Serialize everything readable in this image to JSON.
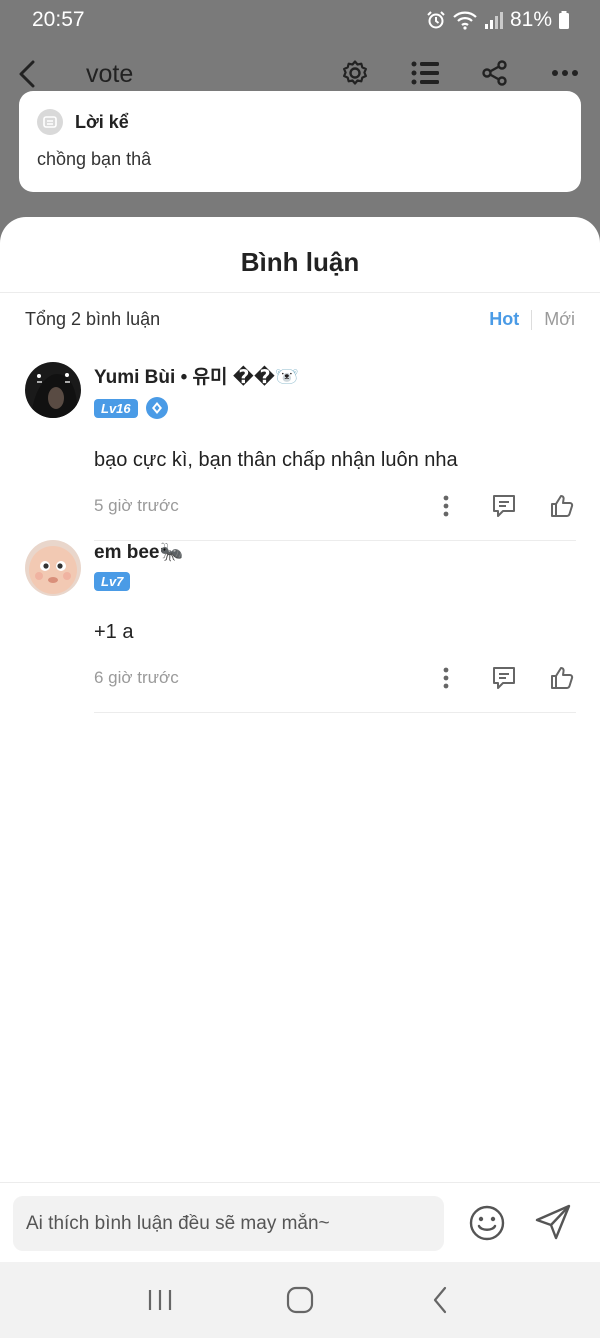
{
  "status_bar": {
    "time": "20:57",
    "battery": "81%"
  },
  "header": {
    "title": "vote",
    "icons": [
      "back-icon",
      "settings-icon",
      "list-icon",
      "share-icon",
      "more-icon"
    ]
  },
  "narration": {
    "label": "Lời kể",
    "text": "chồng bạn thâ"
  },
  "comments_sheet": {
    "title": "Bình luận",
    "total": "Tổng 2 bình luận",
    "sort_tabs": [
      "Hot",
      "Mới"
    ],
    "active_sort": "Hot",
    "comments": [
      {
        "name": "Yumi Bùi • 유미 ��🐻‍❄️",
        "level": "Lv16",
        "has_gem_badge": true,
        "text": "bạo cực kì, bạn thân chấp nhận luôn nha",
        "time": "5 giờ trước"
      },
      {
        "name": "em bee🐜",
        "level": "Lv7",
        "has_gem_badge": false,
        "text": "+1 a",
        "time": "6 giờ trước"
      }
    ]
  },
  "input_bar": {
    "placeholder": "Ai thích bình luận đều sẽ may mắn~"
  },
  "colors": {
    "accent": "#4a9be6",
    "overlay": "#7a7a7a",
    "muted_text": "#9a9a9a"
  }
}
